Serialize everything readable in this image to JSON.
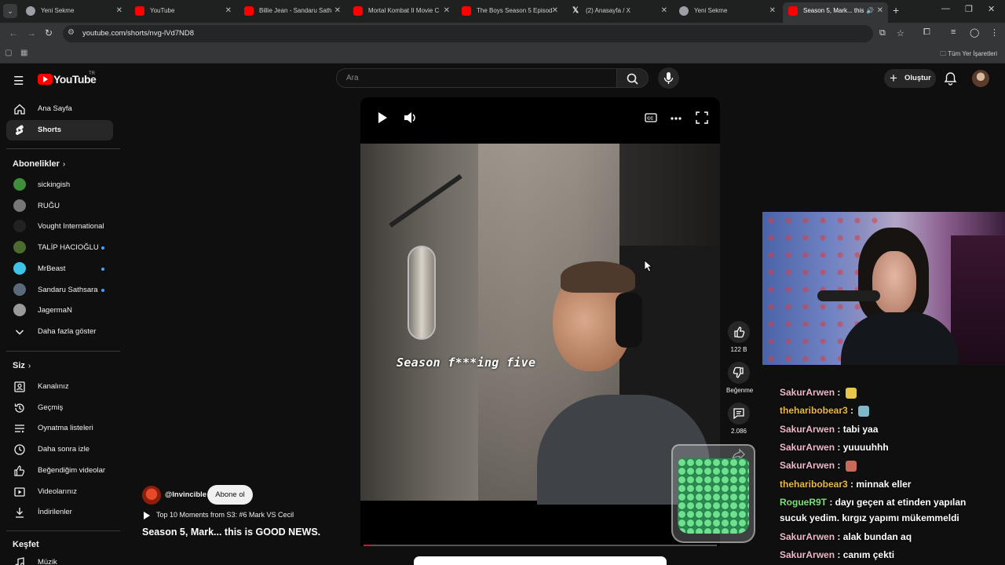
{
  "browser": {
    "tabs": [
      {
        "label": "Yeni Sekme",
        "icon": "google-icon"
      },
      {
        "label": "YouTube",
        "icon": "youtube-icon"
      },
      {
        "label": "Billie Jean - Sandaru Sath",
        "icon": "youtube-icon"
      },
      {
        "label": "Mortal Kombat II Movie C",
        "icon": "youtube-icon"
      },
      {
        "label": "The Boys Season 5 Episod",
        "icon": "youtube-icon"
      },
      {
        "label": "(2) Anasayfa / X",
        "icon": "x-icon"
      },
      {
        "label": "Yeni Sekme",
        "icon": "google-icon"
      },
      {
        "label": "Season 5, Mark... this",
        "icon": "youtube-icon",
        "active": true
      }
    ],
    "url": "youtube.com/shorts/nvg-lVd7ND8",
    "bookmarks_all": "Tüm Yer İşaretleri"
  },
  "header": {
    "logo": "YouTube",
    "country": "TR",
    "search_placeholder": "Ara",
    "create_label": "Oluştur"
  },
  "sidebar": {
    "main": [
      {
        "label": "Ana Sayfa",
        "icon": "home-icon"
      },
      {
        "label": "Shorts",
        "icon": "shorts-icon",
        "active": true
      }
    ],
    "subscriptions_title": "Abonelikler",
    "subscriptions": [
      {
        "label": "sickingish",
        "live": false,
        "color": "#3f8f3a"
      },
      {
        "label": "RUĞU",
        "live": false,
        "color": "#777777"
      },
      {
        "label": "Vought International",
        "live": false,
        "color": "#222222"
      },
      {
        "label": "TALİP HACIOĞLU",
        "live": true,
        "color": "#4d6b2e"
      },
      {
        "label": "MrBeast",
        "live": true,
        "color": "#3ec3e8"
      },
      {
        "label": "Sandaru Sathsara",
        "live": true,
        "color": "#5a6a7a"
      },
      {
        "label": "JagermaN",
        "live": false,
        "color": "#9a9a9a"
      }
    ],
    "show_more": "Daha fazla göster",
    "you_title": "Siz",
    "you": [
      {
        "label": "Kanalınız",
        "icon": "channel-icon"
      },
      {
        "label": "Geçmiş",
        "icon": "history-icon"
      },
      {
        "label": "Oynatma listeleri",
        "icon": "playlist-icon"
      },
      {
        "label": "Daha sonra izle",
        "icon": "clock-icon"
      },
      {
        "label": "Beğendiğim videolar",
        "icon": "like-icon"
      },
      {
        "label": "Videolarınız",
        "icon": "video-icon"
      },
      {
        "label": "İndirilenler",
        "icon": "download-icon"
      }
    ],
    "explore_title": "Keşfet",
    "explore": [
      {
        "label": "Müzik",
        "icon": "music-icon"
      }
    ]
  },
  "video": {
    "caption": "Season f***ing five",
    "progress": 0.02
  },
  "actions": {
    "likes": "122 B",
    "dislike_label": "Beğenme",
    "comments": "2.086"
  },
  "channel": {
    "handle": "@Invincible",
    "subscribe_label": "Abone ol",
    "related": "Top 10 Moments from S3: #6 Mark VS Cecil",
    "title": "Season 5, Mark... this is GOOD NEWS."
  },
  "chat": [
    {
      "user": "SakurArwen",
      "text": "",
      "emote": "#e8c84a",
      "user_color": "#f0b8c8"
    },
    {
      "user": "theharibobear3",
      "text": "",
      "emote": "#7fb8c8",
      "user_color": "#e8b84a"
    },
    {
      "user": "SakurArwen",
      "text": "tabi yaa",
      "user_color": "#f0b8c8"
    },
    {
      "user": "SakurArwen",
      "text": "yuuuuhhh",
      "user_color": "#f0b8c8"
    },
    {
      "user": "SakurArwen",
      "text": "",
      "emote": "#c86a5a",
      "user_color": "#f0b8c8"
    },
    {
      "user": "theharibobear3",
      "text": "minnak eller",
      "user_color": "#e8b84a"
    },
    {
      "user": "RogueR9T",
      "text": "dayı geçen at etinden yapılan",
      "user_color": "#7ee07a"
    },
    {
      "user": "",
      "text": "sucuk yedim. kırgız yapımı mükemmeldi",
      "user_color": "#ffffff"
    },
    {
      "user": "SakurArwen",
      "text": "alak bundan aq",
      "user_color": "#f0b8c8"
    },
    {
      "user": "SakurArwen",
      "text": "canım çekti",
      "user_color": "#f0b8c8"
    }
  ]
}
